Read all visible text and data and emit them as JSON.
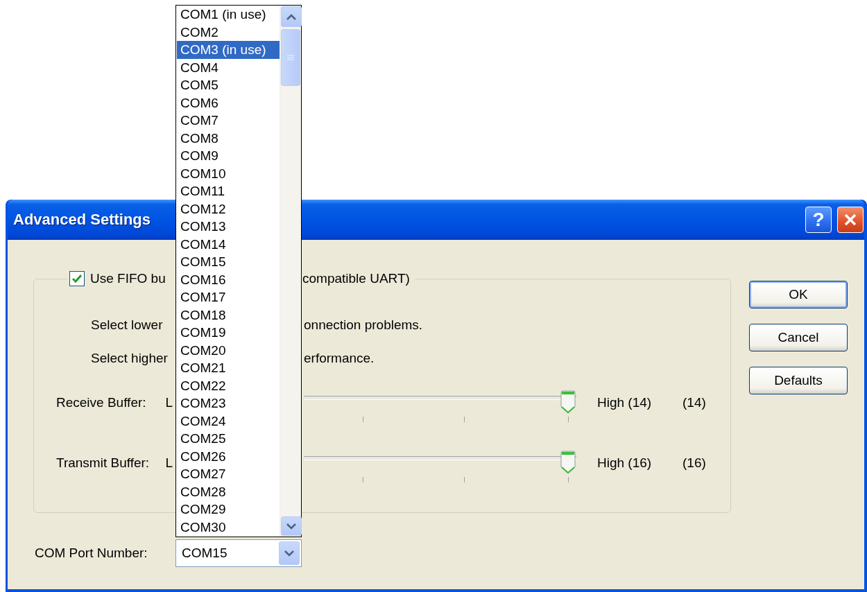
{
  "window": {
    "title": "Advanced Settings",
    "help_label": "?"
  },
  "fifo": {
    "checked": true,
    "label_left": "Use FIFO bu",
    "label_right": "compatible UART)"
  },
  "hints": [
    {
      "left": "Select lower",
      "right": "onnection problems."
    },
    {
      "left": "Select higher",
      "right": "erformance."
    }
  ],
  "sliders": [
    {
      "label": "Receive Buffer:",
      "low_label": "L",
      "level": 1,
      "high_label": "High (14)",
      "reading": "(14)"
    },
    {
      "label": "Transmit Buffer:",
      "low_label": "L",
      "level": 1,
      "high_label": "High (16)",
      "reading": "(16)"
    }
  ],
  "port": {
    "label": "COM Port Number:",
    "value": "COM15"
  },
  "buttons": [
    {
      "label": "OK",
      "default": true
    },
    {
      "label": "Cancel",
      "default": false
    },
    {
      "label": "Defaults",
      "default": false
    }
  ],
  "port_list": [
    {
      "label": "COM1 (in use)",
      "selected": false
    },
    {
      "label": "COM2",
      "selected": false
    },
    {
      "label": "COM3 (in use)",
      "selected": true
    },
    {
      "label": "COM4",
      "selected": false
    },
    {
      "label": "COM5",
      "selected": false
    },
    {
      "label": "COM6",
      "selected": false
    },
    {
      "label": "COM7",
      "selected": false
    },
    {
      "label": "COM8",
      "selected": false
    },
    {
      "label": "COM9",
      "selected": false
    },
    {
      "label": "COM10",
      "selected": false
    },
    {
      "label": "COM11",
      "selected": false
    },
    {
      "label": "COM12",
      "selected": false
    },
    {
      "label": "COM13",
      "selected": false
    },
    {
      "label": "COM14",
      "selected": false
    },
    {
      "label": "COM15",
      "selected": false
    },
    {
      "label": "COM16",
      "selected": false
    },
    {
      "label": "COM17",
      "selected": false
    },
    {
      "label": "COM18",
      "selected": false
    },
    {
      "label": "COM19",
      "selected": false
    },
    {
      "label": "COM20",
      "selected": false
    },
    {
      "label": "COM21",
      "selected": false
    },
    {
      "label": "COM22",
      "selected": false
    },
    {
      "label": "COM23",
      "selected": false
    },
    {
      "label": "COM24",
      "selected": false
    },
    {
      "label": "COM25",
      "selected": false
    },
    {
      "label": "COM26",
      "selected": false
    },
    {
      "label": "COM27",
      "selected": false
    },
    {
      "label": "COM28",
      "selected": false
    },
    {
      "label": "COM29",
      "selected": false
    },
    {
      "label": "COM30",
      "selected": false
    }
  ]
}
